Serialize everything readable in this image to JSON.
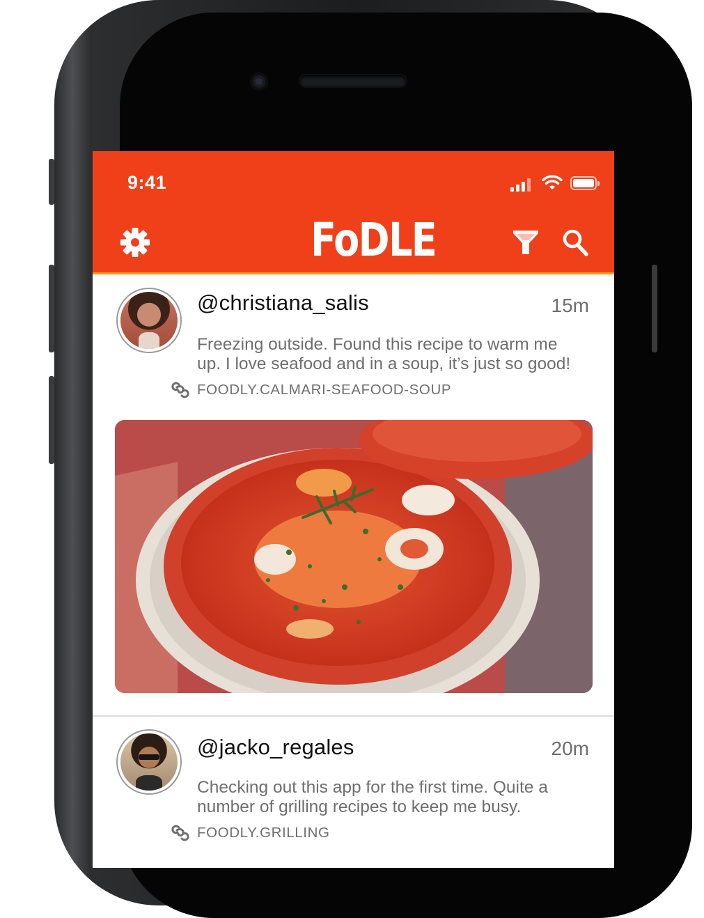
{
  "status_bar": {
    "time": "9:41"
  },
  "app_bar": {
    "logo": "FoDLE"
  },
  "posts": [
    {
      "username": "@christiana_salis",
      "time_ago": "15m",
      "text_line1": "Freezing outside. Found this recipe to warm me",
      "text_line2": "up. I love seafood and in a soup, it’s just so good!",
      "link": "FOODLY.CALMARI-SEAFOOD-SOUP"
    },
    {
      "username": "@jacko_regales",
      "time_ago": "20m",
      "text_line1": "Checking out this app for the first time. Quite a",
      "text_line2": "number of grilling recipes to keep me busy.",
      "link": "FOODLY.GRILLING"
    }
  ],
  "colors": {
    "accent": "#f0401a",
    "accent_underline": "#f59a1a",
    "text_muted": "#6e6e6e"
  }
}
